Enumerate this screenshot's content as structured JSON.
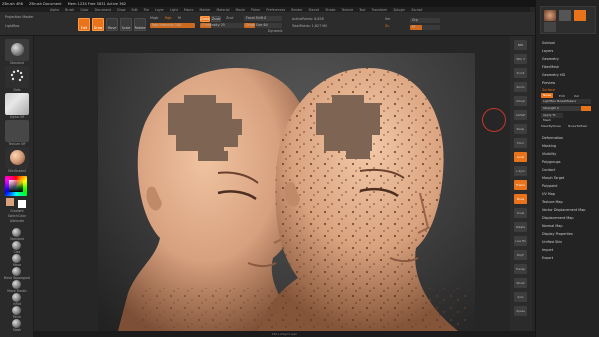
{
  "titlebar": {
    "app_name": "ZBrush 4R6",
    "doc_info": "ZBrush Document",
    "stats": "Mem 1234 Free 5831 Active 362",
    "right_btn_1": "Menus",
    "right_btn_2": "DefaultZScript"
  },
  "menubar": {
    "items": [
      "Alpha",
      "Brush",
      "Color",
      "Document",
      "Draw",
      "Edit",
      "File",
      "Layer",
      "Light",
      "Macro",
      "Marker",
      "Material",
      "Movie",
      "Picker",
      "Preferences",
      "Render",
      "Stencil",
      "Stroke",
      "Texture",
      "Tool",
      "Transform",
      "Zplugin",
      "Zscript"
    ]
  },
  "topshelf": {
    "projection_master": "Projection Master",
    "lightbox": "LightBox",
    "edit_btn": "Edit",
    "draw_btn": "Draw",
    "move_btn": "Move",
    "scale_btn": "Scale",
    "rotate_btn": "Rotate",
    "mrgb": "Mrgb",
    "rgb": "Rgb",
    "m": "M",
    "zadd": "Zadd",
    "zsub": "Zsub",
    "zcut": "Zcut",
    "rgb_intensity": "Rgb Intensity 100",
    "z_intensity": "Z Intensity 25",
    "focal_shift": "Focal Shift 0",
    "draw_size": "Draw Size 64",
    "dynamic": "Dynamic",
    "active_points": "ActivePoints: 6,858",
    "total_points": "TotalPoints: 1,627 Mil",
    "rgb_intensity_level": 1.0,
    "z_intensity_level": 0.25
  },
  "lefttray": {
    "brush_label": "Standard",
    "stroke_label": "Dots",
    "alpha_label": "Alpha Off",
    "texture_label": "Texture Off",
    "material_label": "SkinShade4",
    "gradient_label": "Gradient",
    "switch_color": "SwitchColor",
    "alternate": "Alternate",
    "tools": [
      "Standard",
      "Clay",
      "Move",
      "Move Topological",
      "Move Elastic",
      "Inflat",
      "Pinch",
      "Slash"
    ]
  },
  "rightshelf": {
    "items": [
      "BPR",
      "SPix 3",
      "Scroll",
      "Zoom",
      "Actual",
      "AAHalf",
      "Persp",
      "Floor",
      "Local",
      "L.Sym",
      "Frame",
      "Move",
      "Scale",
      "Rotate",
      "Line Fill",
      "PolyF",
      "Transp",
      "Ghost",
      "Solo",
      "Xpose"
    ],
    "active_items": [
      "Local",
      "Frame",
      "Move"
    ]
  },
  "rightpalette": {
    "top_label": "Brush Standard",
    "subtool": "Subtool",
    "layers": "Layers",
    "geometry": "Geometry",
    "fibermesh": "FiberMesh",
    "geometry_hd": "Geometry HD",
    "preview": "Preview",
    "surface": "Surface",
    "noise_btn": "Noise",
    "edit_btn": "Edit",
    "del_btn": "Del",
    "lightbox_noisemakers": "LightBox NoiseMakers",
    "apply_to_mesh": "Apply To Mesh",
    "mask_by_noise": "MaskByNoise",
    "noise_to_mask": "NoiseToMask",
    "strength": "Strength 0",
    "deformation": "Deformation",
    "masking": "Masking",
    "visibility": "Visibility",
    "polygroups": "Polygroups",
    "contact": "Contact",
    "morph_target": "Morph Target",
    "polypaint": "Polypaint",
    "uv_map": "UV Map",
    "texture_map": "Texture Map",
    "vector_displacement_map": "Vector Displacement Map",
    "displacement_map": "Displacement Map",
    "normal_map": "Normal Map",
    "display_properties": "Display Properties",
    "unified_skin": "Unified Skin",
    "import": "Import",
    "export": "Export"
  },
  "bottombar": {
    "text": "Ctrl+drag to pan"
  },
  "colors": {
    "accent": "#e8731b",
    "skin": "#d9a27e"
  }
}
